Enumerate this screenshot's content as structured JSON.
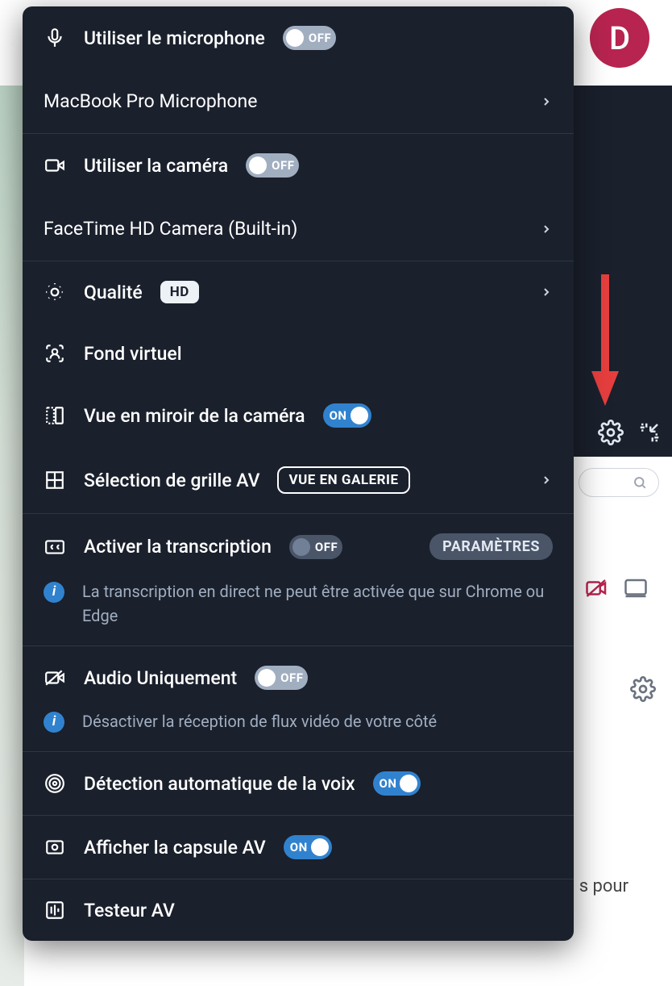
{
  "avatar": {
    "initial": "D"
  },
  "truncated_bg_text": "s pour",
  "panel": {
    "microphone": {
      "label": "Utiliser le microphone",
      "toggle": "OFF"
    },
    "mic_device": {
      "label": "MacBook Pro Microphone"
    },
    "camera": {
      "label": "Utiliser la caméra",
      "toggle": "OFF"
    },
    "cam_device": {
      "label": "FaceTime HD Camera (Built-in)"
    },
    "quality": {
      "label": "Qualité",
      "badge": "HD"
    },
    "virtual_bg": {
      "label": "Fond virtuel"
    },
    "mirror": {
      "label": "Vue en miroir de la caméra",
      "toggle": "ON"
    },
    "grid": {
      "label": "Sélection de grille AV",
      "badge": "VUE EN GALERIE"
    },
    "transcription": {
      "label": "Activer la transcription",
      "toggle": "OFF",
      "settings": "PARAMÈTRES"
    },
    "transcription_info": "La transcription en direct ne peut être activée que sur Chrome ou Edge",
    "audio_only": {
      "label": "Audio Uniquement",
      "toggle": "OFF"
    },
    "audio_only_info": "Désactiver la réception de flux vidéo de votre côté",
    "voice_detect": {
      "label": "Détection automatique de la voix",
      "toggle": "ON"
    },
    "capsule": {
      "label": "Afficher la capsule AV",
      "toggle": "ON"
    },
    "tester": {
      "label": "Testeur AV"
    }
  }
}
